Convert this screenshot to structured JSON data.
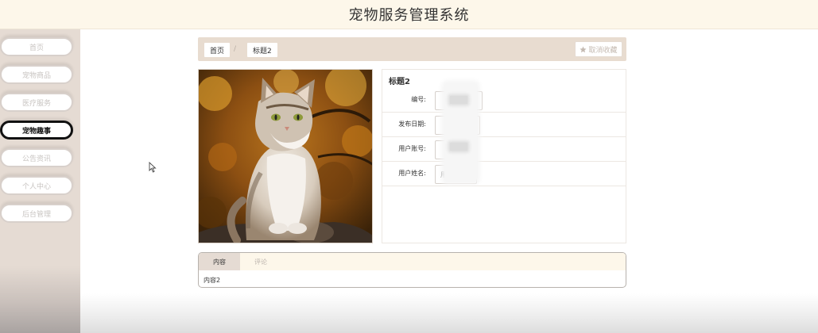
{
  "header": {
    "title": "宠物服务管理系统"
  },
  "sidebar": {
    "items": [
      {
        "label": "首页"
      },
      {
        "label": "宠物商品"
      },
      {
        "label": "医疗服务"
      },
      {
        "label": "宠物趣事"
      },
      {
        "label": "公告资讯"
      },
      {
        "label": "个人中心"
      },
      {
        "label": "后台管理"
      }
    ],
    "active_index": 3
  },
  "breadcrumb": {
    "home": "首页",
    "separator": "/",
    "current": "标题2"
  },
  "favorite": {
    "icon": "star-icon",
    "label": "取消收藏"
  },
  "detail": {
    "title": "标题2",
    "image": "cat-photo",
    "fields": [
      {
        "label": "编号:",
        "value": ""
      },
      {
        "label": "发布日期:",
        "value": ""
      },
      {
        "label": "用户账号:",
        "value": ""
      },
      {
        "label": "用户姓名:",
        "value": "用户姓名2"
      }
    ]
  },
  "tabs": {
    "items": [
      {
        "label": "内容"
      },
      {
        "label": "评论"
      }
    ],
    "active_index": 0,
    "content": "内容2"
  },
  "colors": {
    "header_bg": "#fdf7ea",
    "sidebar_bg": "#e5dbd3",
    "accent": "#e8dcd0"
  }
}
